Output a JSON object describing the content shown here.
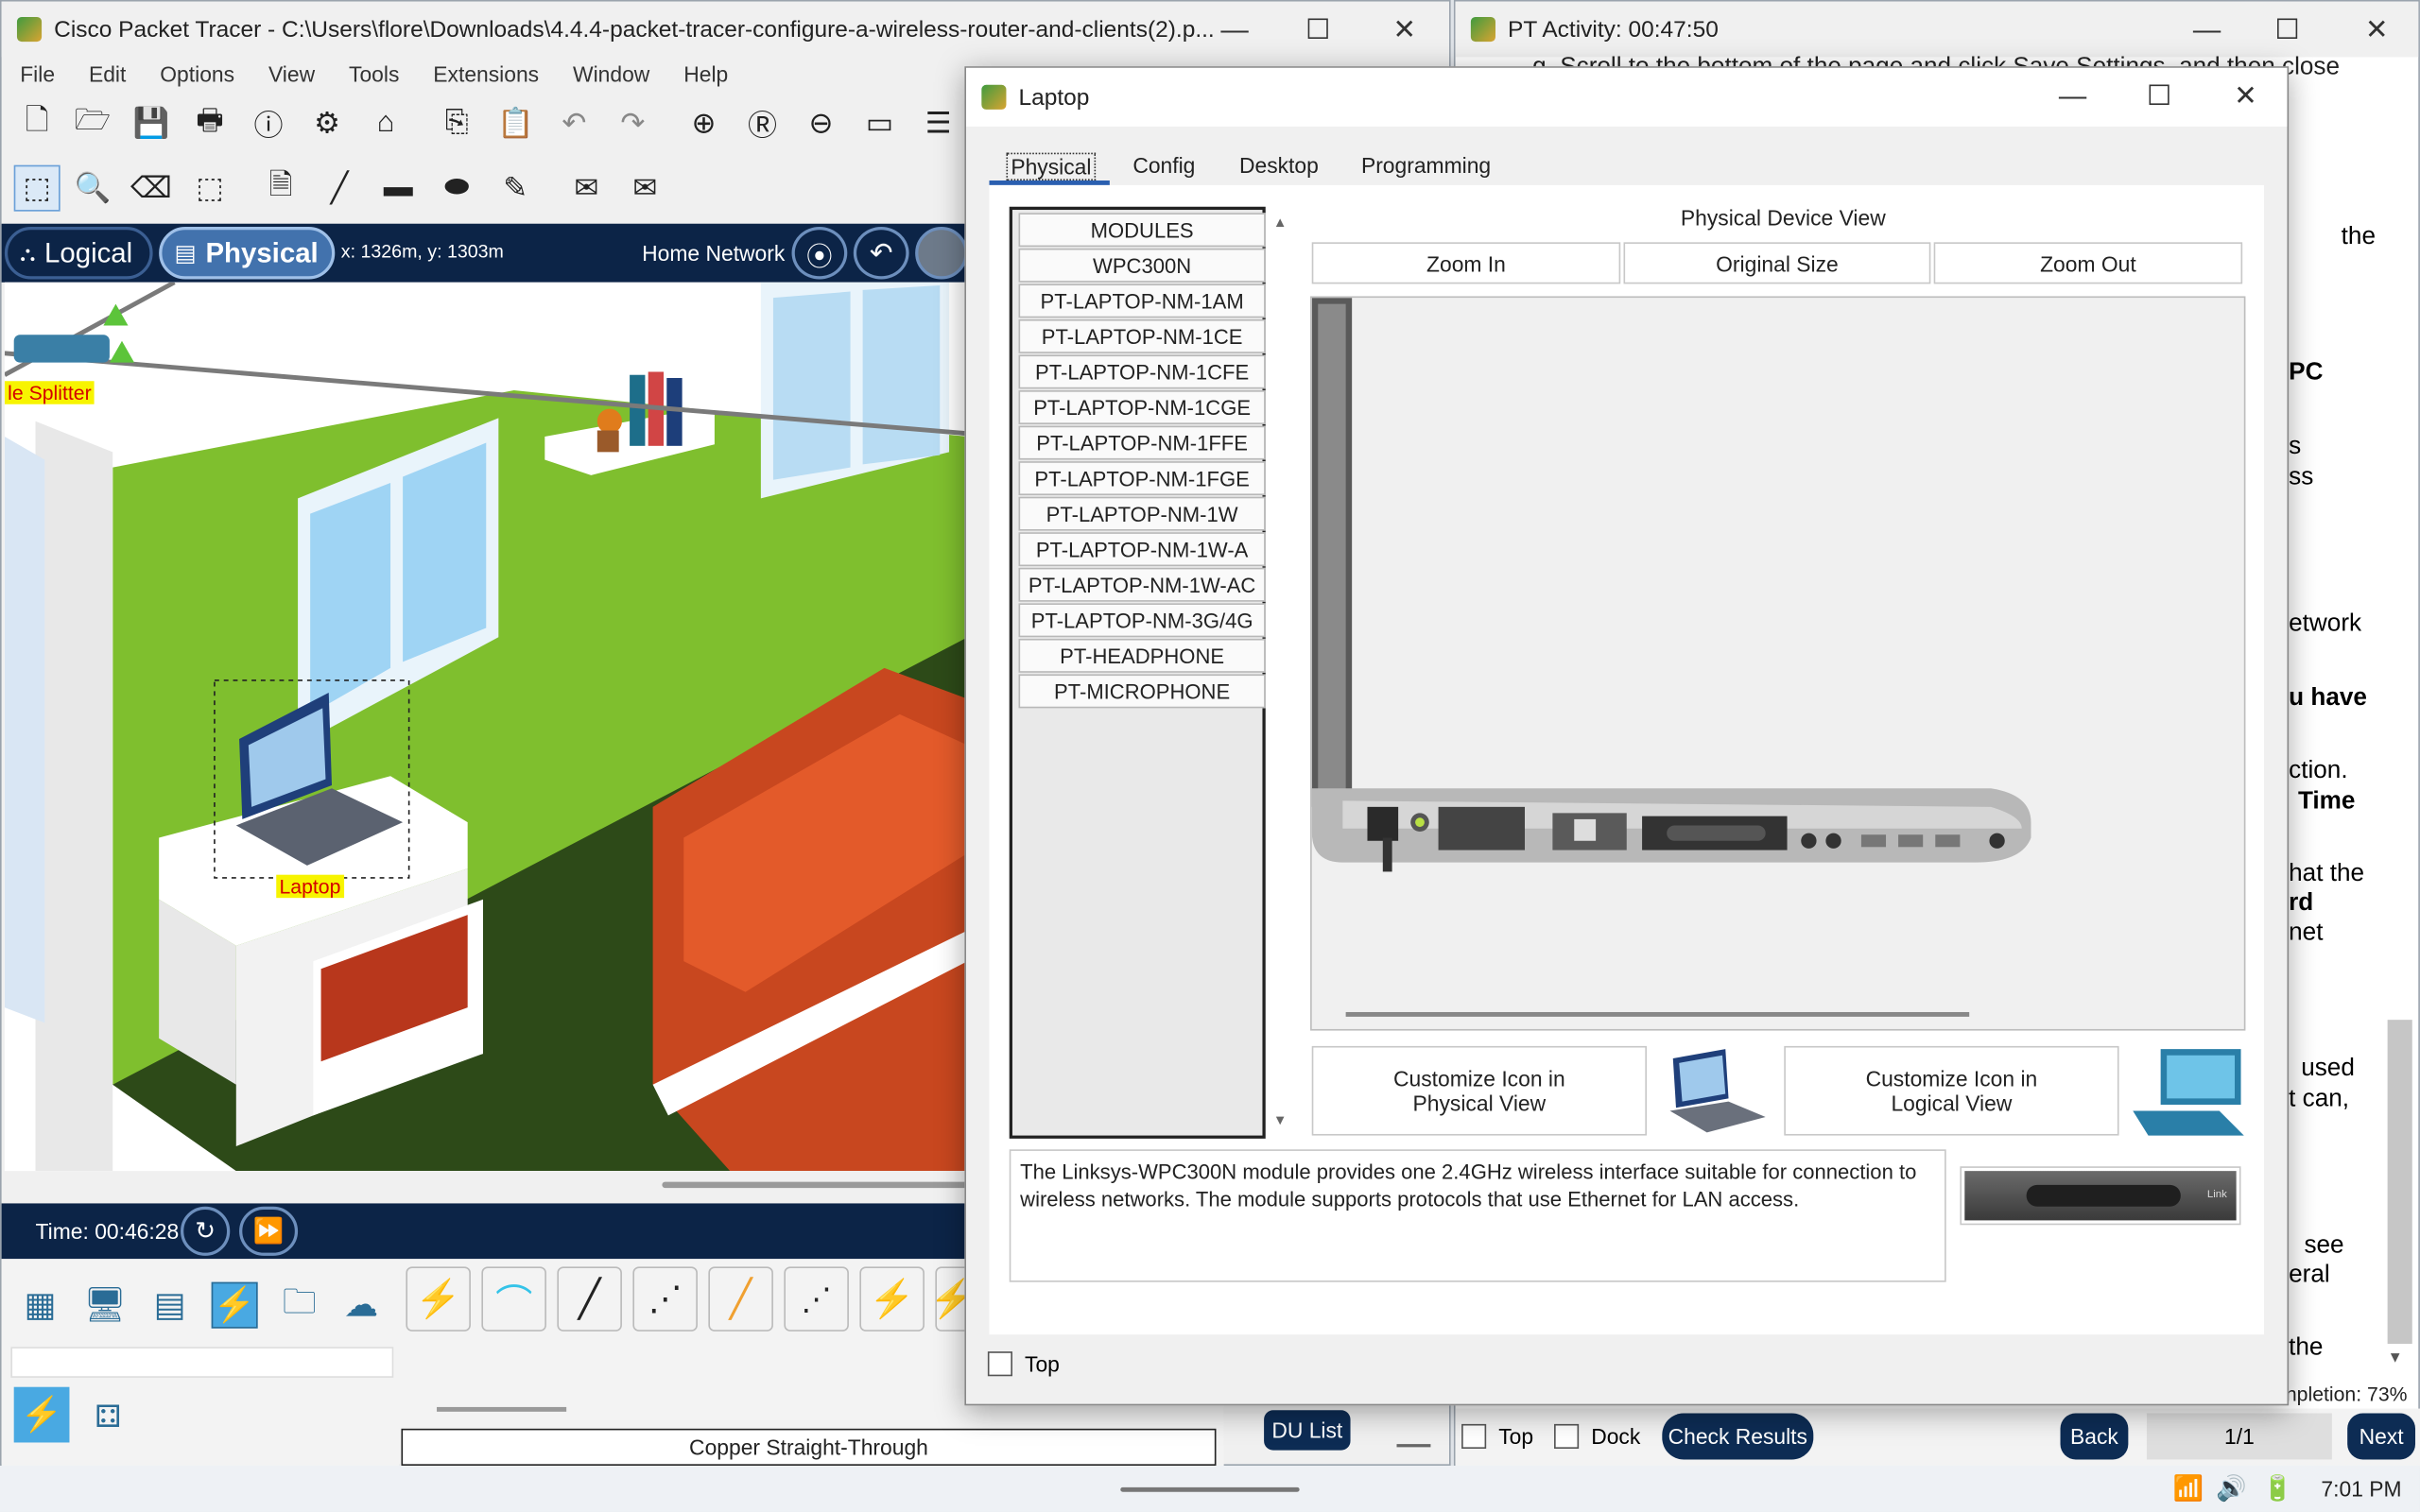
{
  "main_window": {
    "title": "Cisco Packet Tracer - C:\\Users\\flore\\Downloads\\4.4.4-packet-tracer-configure-a-wireless-router-and-clients(2).p...",
    "menu": [
      "File",
      "Edit",
      "Options",
      "View",
      "Tools",
      "Extensions",
      "Window",
      "Help"
    ],
    "logical_label": "Logical",
    "physical_label": "Physical",
    "coords": "x: 1326m, y: 1303m",
    "location": "Home Network",
    "splitter_label": "le Splitter",
    "laptop_label": "Laptop",
    "time": "Time: 00:46:28",
    "cable_status": "Copper Straight-Through",
    "pdu_list": "DU List"
  },
  "activity_window": {
    "title": "PT Activity: 00:47:50",
    "instruction_top": "g. Scroll to the bottom of the page and click Save Settings, and then close",
    "fragments": [
      "the",
      "PC",
      "s",
      "ss",
      "etwork",
      "u have",
      "ction.",
      "Time",
      "hat the",
      "rd",
      "net",
      "used",
      "t can,",
      "see",
      "eral",
      "the"
    ],
    "completion": "npletion: 73%",
    "top_label": "Top",
    "dock_label": "Dock",
    "check_results": "Check Results",
    "back": "Back",
    "page": "1/1",
    "next": "Next"
  },
  "laptop_dialog": {
    "title": "Laptop",
    "tabs": [
      "Physical",
      "Config",
      "Desktop",
      "Programming"
    ],
    "active_tab": "Physical",
    "modules": [
      "MODULES",
      "WPC300N",
      "PT-LAPTOP-NM-1AM",
      "PT-LAPTOP-NM-1CE",
      "PT-LAPTOP-NM-1CFE",
      "PT-LAPTOP-NM-1CGE",
      "PT-LAPTOP-NM-1FFE",
      "PT-LAPTOP-NM-1FGE",
      "PT-LAPTOP-NM-1W",
      "PT-LAPTOP-NM-1W-A",
      "PT-LAPTOP-NM-1W-AC",
      "PT-LAPTOP-NM-3G/4G",
      "PT-HEADPHONE",
      "PT-MICROPHONE"
    ],
    "device_view_title": "Physical Device View",
    "zoom_in": "Zoom In",
    "original_size": "Original Size",
    "zoom_out": "Zoom Out",
    "customize_physical": "Customize Icon in Physical View",
    "customize_logical": "Customize Icon in Logical View",
    "description": "The Linksys-WPC300N module provides one 2.4GHz wireless interface suitable for connection to wireless networks. The module supports protocols that use Ethernet for LAN access.",
    "module_thumb_label": "Link",
    "top_label": "Top"
  },
  "taskbar": {
    "clock": "7:01 PM"
  }
}
